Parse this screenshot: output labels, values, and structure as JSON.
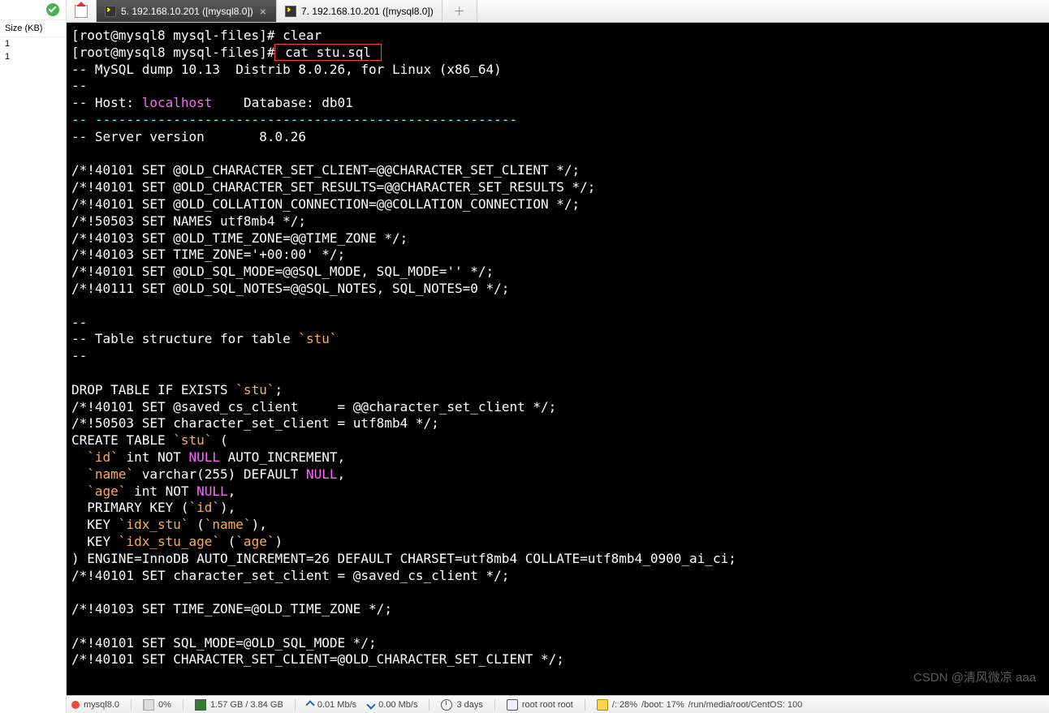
{
  "left": {
    "size_header": "Size (KB)",
    "rows": [
      "1",
      "1"
    ]
  },
  "tabs": {
    "tab5_label": "5. 192.168.10.201 ([mysql8.0])",
    "tab7_label": "7. 192.168.10.201 ([mysql8.0])"
  },
  "terminal": {
    "prompt1_user": "[root@mysql8 mysql-files]#",
    "cmd1": " clear",
    "prompt2_user": "[root@mysql8 mysql-files]#",
    "cmd2_boxed": " cat stu.sql ",
    "l_dumpver": "-- MySQL dump 10.13  Distrib 8.0.26, for Linux (x86_64)",
    "l_dash1": "--",
    "l_host_pre": "-- Host: ",
    "l_host_val": "localhost",
    "l_host_post": "    Database: db01",
    "l_sep": "-- ------------------------------------------------------",
    "l_srvver": "-- Server version       8.0.26",
    "s_01": "/*!40101 SET @OLD_CHARACTER_SET_CLIENT=@@CHARACTER_SET_CLIENT */;",
    "s_02": "/*!40101 SET @OLD_CHARACTER_SET_RESULTS=@@CHARACTER_SET_RESULTS */;",
    "s_03": "/*!40101 SET @OLD_COLLATION_CONNECTION=@@COLLATION_CONNECTION */;",
    "s_04": "/*!50503 SET NAMES utf8mb4 */;",
    "s_05": "/*!40103 SET @OLD_TIME_ZONE=@@TIME_ZONE */;",
    "s_06": "/*!40103 SET TIME_ZONE='+00:00' */;",
    "s_07": "/*!40101 SET @OLD_SQL_MODE=@@SQL_MODE, SQL_MODE='' */;",
    "s_08": "/*!40111 SET @OLD_SQL_NOTES=@@SQL_NOTES, SQL_NOTES=0 */;",
    "ts_dash1": "--",
    "ts_label_pre": "-- Table structure for table ",
    "ts_label_val": "`stu`",
    "ts_dash2": "--",
    "d_drop_pre": "DROP TABLE IF EXISTS ",
    "d_drop_val": "`stu`",
    "d_drop_post": ";",
    "d_s1": "/*!40101 SET @saved_cs_client     = @@character_set_client */;",
    "d_s2": "/*!50503 SET character_set_client = utf8mb4 */;",
    "d_create_pre": "CREATE TABLE ",
    "d_create_val": "`stu`",
    "d_create_post": " (",
    "col_id_pad": "  ",
    "col_id_name": "`id`",
    "col_id_mid": " int NOT ",
    "col_id_null": "NULL",
    "col_id_post": " AUTO_INCREMENT,",
    "col_name_pad": "  ",
    "col_name_name": "`name`",
    "col_name_mid": " varchar(255) DEFAULT ",
    "col_name_null": "NULL",
    "col_name_post": ",",
    "col_age_pad": "  ",
    "col_age_name": "`age`",
    "col_age_mid": " int NOT ",
    "col_age_null": "NULL",
    "col_age_post": ",",
    "pk_pre": "  PRIMARY KEY (",
    "pk_val": "`id`",
    "pk_post": "),",
    "k1_pre": "  KEY ",
    "k1_name": "`idx_stu`",
    "k1_mid": " (",
    "k1_col": "`name`",
    "k1_post": "),",
    "k2_pre": "  KEY ",
    "k2_name": "`idx_stu_age`",
    "k2_mid": " (",
    "k2_col": "`age`",
    "k2_post": ")",
    "eng": ") ENGINE=InnoDB AUTO_INCREMENT=26 DEFAULT CHARSET=utf8mb4 COLLATE=utf8mb4_0900_ai_ci;",
    "d_s3": "/*!40101 SET character_set_client = @saved_cs_client */;",
    "f_01": "/*!40103 SET TIME_ZONE=@OLD_TIME_ZONE */;",
    "f_02": "/*!40101 SET SQL_MODE=@OLD_SQL_MODE */;",
    "f_03": "/*!40101 SET CHARACTER_SET_CLIENT=@OLD_CHARACTER_SET_CLIENT */;"
  },
  "watermark": "CSDN @清风微凉 aaa",
  "status": {
    "host": "mysql8.0",
    "cpu": "0%",
    "ram": "1.57 GB / 3.84 GB",
    "net_up": "0.01 Mb/s",
    "net_dn": "0.00 Mb/s",
    "uptime": "3 days",
    "user": "root  root  root",
    "disk1": "/: 28%",
    "disk2": "/boot: 17%",
    "disk3": "/run/media/root/CentOS: 100"
  }
}
